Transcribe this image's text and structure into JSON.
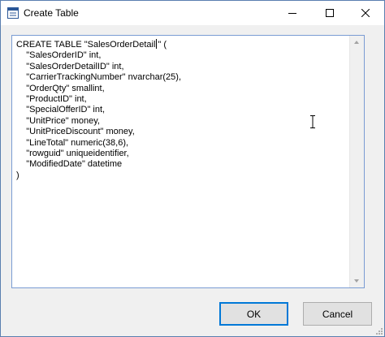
{
  "window": {
    "title": "Create Table",
    "icon": "app-icon"
  },
  "controls": {
    "minimize_icon": "minimize-icon",
    "maximize_icon": "maximize-icon",
    "close_icon": "close-icon"
  },
  "editor": {
    "before_caret": "CREATE TABLE \"SalesOrderDetail",
    "after_caret": "\" (\n    \"SalesOrderID\" int,\n    \"SalesOrderDetailID\" int,\n    \"CarrierTrackingNumber\" nvarchar(25),\n    \"OrderQty\" smallint,\n    \"ProductID\" int,\n    \"SpecialOfferID\" int,\n    \"UnitPrice\" money,\n    \"UnitPriceDiscount\" money,\n    \"LineTotal\" numeric(38,6),\n    \"rowguid\" uniqueidentifier,\n    \"ModifiedDate\" datetime\n)"
  },
  "buttons": {
    "ok": "OK",
    "cancel": "Cancel"
  },
  "colors": {
    "accent": "#0078d7",
    "editor_border": "#7a9cd3",
    "dialog_bg": "#f0f0f0"
  }
}
